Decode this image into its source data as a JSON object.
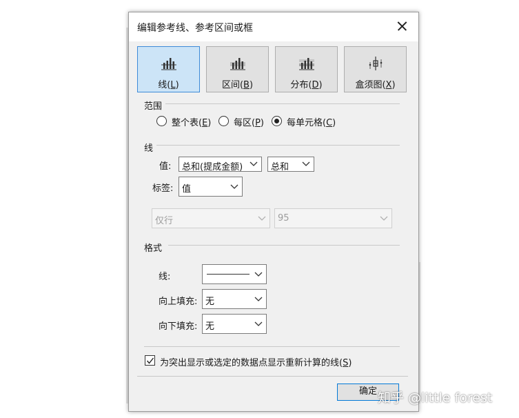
{
  "dialog": {
    "title": "编辑参考线、参考区间或框",
    "close_glyph": "✕"
  },
  "tabs": [
    {
      "label": "线(",
      "key": "L",
      "suffix": ")",
      "selected": true,
      "icon": "reference-line-icon"
    },
    {
      "label": "区间(",
      "key": "B",
      "suffix": ")",
      "selected": false,
      "icon": "reference-band-icon"
    },
    {
      "label": "分布(",
      "key": "D",
      "suffix": ")",
      "selected": false,
      "icon": "distribution-icon"
    },
    {
      "label": "盒须图(",
      "key": "X",
      "suffix": ")",
      "selected": false,
      "icon": "box-plot-icon"
    }
  ],
  "scope": {
    "heading": "范围",
    "options": [
      {
        "label": "整个表(",
        "key": "E",
        "suffix": ")",
        "checked": false
      },
      {
        "label": "每区(",
        "key": "P",
        "suffix": ")",
        "checked": false
      },
      {
        "label": "每单元格(",
        "key": "C",
        "suffix": ")",
        "checked": true
      }
    ]
  },
  "line": {
    "heading": "线",
    "value_label": "值:",
    "value_field": "总和(提成金额)",
    "value_agg": "总和",
    "tag_label": "标签:",
    "tag_value": "值",
    "disabled_a": "仅行",
    "disabled_b": "95"
  },
  "format": {
    "heading": "格式",
    "line_label": "线:",
    "fill_above_label": "向上填充:",
    "fill_above_value": "无",
    "fill_below_label": "向下填充:",
    "fill_below_value": "无"
  },
  "recalc": {
    "label": "为突出显示或选定的数据点显示重新计算的线(",
    "key": "S",
    "suffix": ")",
    "checked": true
  },
  "ok_button": "确定",
  "watermark": "知乎 @little forest"
}
